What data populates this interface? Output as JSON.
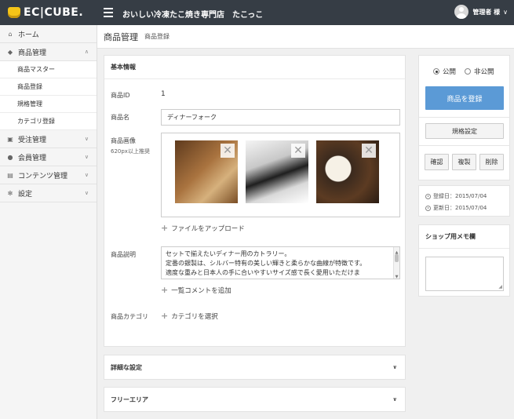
{
  "header": {
    "logo": "EC|CUBE.",
    "shop_name": "おいしい冷凍たこ焼き専門店　たこっこ",
    "user_name": "管理者 様",
    "user_chevron": "∨"
  },
  "sidebar": {
    "items": [
      {
        "label": "ホーム",
        "icon": "home-icon"
      },
      {
        "label": "商品管理",
        "icon": "tag-icon",
        "chevron": "∧"
      },
      {
        "label": "受注管理",
        "icon": "cart-icon",
        "chevron": "∨"
      },
      {
        "label": "会員管理",
        "icon": "users-icon",
        "chevron": "∨"
      },
      {
        "label": "コンテンツ管理",
        "icon": "file-icon",
        "chevron": "∨"
      },
      {
        "label": "設定",
        "icon": "gear-icon",
        "chevron": "∨"
      }
    ],
    "sub_items": [
      "商品マスター",
      "商品登録",
      "規格管理",
      "カテゴリ登録"
    ]
  },
  "page": {
    "title": "商品管理",
    "subtitle": "商品登録"
  },
  "basic": {
    "heading": "基本情報",
    "id_label": "商品ID",
    "id_value": "1",
    "name_label": "商品名",
    "name_value": "ディナーフォーク",
    "image_label": "商品画像",
    "image_hint": "620px以上推奨",
    "upload_label": "ファイルをアップロード",
    "desc_label": "商品説明",
    "desc_lines": [
      "セットで揃えたいディナー用のカトラリー。",
      "定番の銀製は、シルバー特有の美しい輝きと柔らかな曲線が特徴です。",
      "適度な重みと日本人の手に合いやすいサイズ感で長く愛用いただけま"
    ],
    "add_comment_label": "一覧コメントを追加",
    "category_label": "商品カテゴリ",
    "category_select_label": "カテゴリを選択"
  },
  "sections": {
    "detail_label": "詳細な設定",
    "free_area_label": "フリーエリア"
  },
  "publish": {
    "public_label": "公開",
    "private_label": "非公開",
    "public_selected": true,
    "register_label": "商品を登録",
    "spec_label": "規格設定",
    "confirm_label": "確認",
    "copy_label": "複製",
    "delete_label": "削除",
    "created": "登録日：2015/07/04",
    "updated": "更新日：2015/07/04"
  },
  "memo": {
    "heading": "ショップ用メモ欄"
  },
  "colors": {
    "header_bg": "#363d45",
    "primary": "#5b9ad6",
    "logo_accent": "#f5c518"
  }
}
